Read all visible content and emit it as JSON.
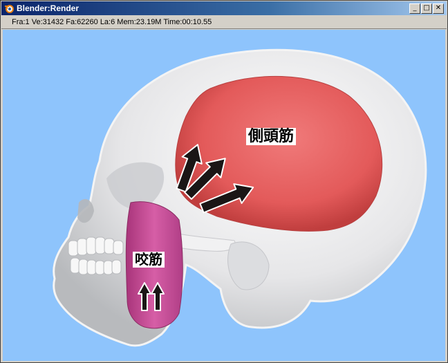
{
  "window": {
    "title": "Blender:Render",
    "minimize_glyph": "_",
    "maximize_glyph": "□",
    "close_glyph": "✕"
  },
  "status": {
    "text": "Fra:1  Ve:31432 Fa:62260 La:6 Mem:23.19M Time:00:10.55"
  },
  "labels": {
    "temporalis": "側頭筋",
    "masseter": "咬筋"
  },
  "colors": {
    "viewport_bg": "#8ec4fc",
    "temporalis": "#e35a5a",
    "masseter": "#c84a96",
    "skull": "#e6e6e8"
  }
}
